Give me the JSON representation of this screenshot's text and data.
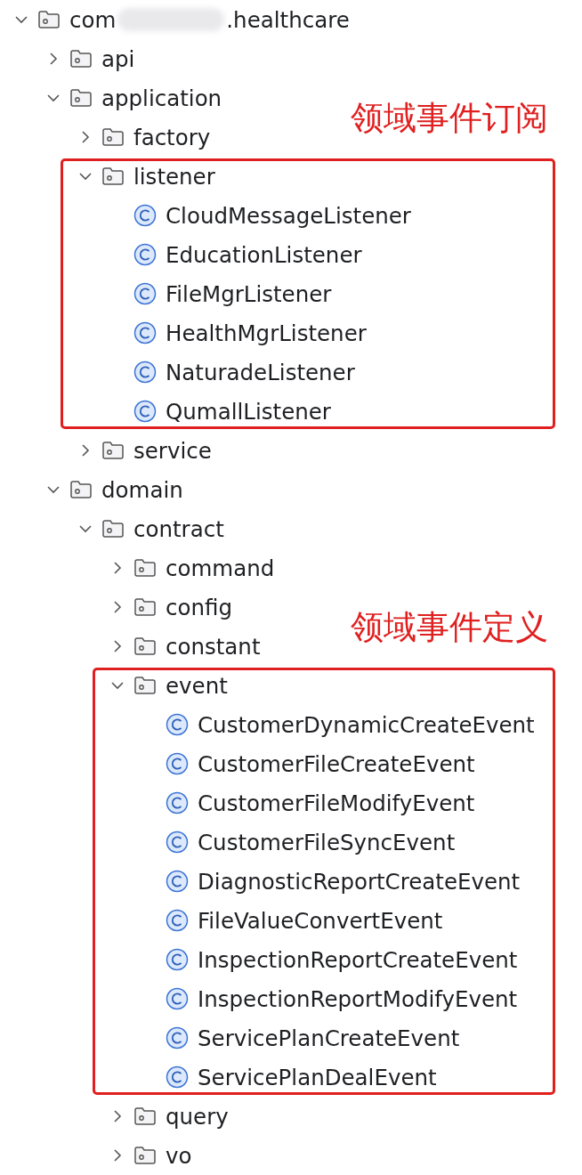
{
  "tree": [
    {
      "kind": "package",
      "label": "com",
      "label_after_blur": ".healthcare",
      "expanded": true,
      "children": [
        {
          "kind": "package",
          "label": "api",
          "expanded": false
        },
        {
          "kind": "package",
          "label": "application",
          "expanded": true,
          "children": [
            {
              "kind": "package",
              "label": "factory",
              "expanded": false
            },
            {
              "kind": "package",
              "label": "listener",
              "expanded": true,
              "highlighted": true,
              "note": "领域事件订阅",
              "children": [
                {
                  "kind": "class",
                  "label": "CloudMessageListener"
                },
                {
                  "kind": "class",
                  "label": "EducationListener"
                },
                {
                  "kind": "class",
                  "label": "FileMgrListener"
                },
                {
                  "kind": "class",
                  "label": "HealthMgrListener"
                },
                {
                  "kind": "class",
                  "label": "NaturadeListener"
                },
                {
                  "kind": "class",
                  "label": "QumallListener"
                }
              ]
            },
            {
              "kind": "package",
              "label": "service",
              "expanded": false
            }
          ]
        },
        {
          "kind": "package",
          "label": "domain",
          "expanded": true,
          "children": [
            {
              "kind": "package",
              "label": "contract",
              "expanded": true,
              "children": [
                {
                  "kind": "package",
                  "label": "command",
                  "expanded": false
                },
                {
                  "kind": "package",
                  "label": "config",
                  "expanded": false
                },
                {
                  "kind": "package",
                  "label": "constant",
                  "expanded": false
                },
                {
                  "kind": "package",
                  "label": "event",
                  "expanded": true,
                  "highlighted": true,
                  "note": "领域事件定义",
                  "children": [
                    {
                      "kind": "class",
                      "label": "CustomerDynamicCreateEvent"
                    },
                    {
                      "kind": "class",
                      "label": "CustomerFileCreateEvent"
                    },
                    {
                      "kind": "class",
                      "label": "CustomerFileModifyEvent"
                    },
                    {
                      "kind": "class",
                      "label": "CustomerFileSyncEvent"
                    },
                    {
                      "kind": "class",
                      "label": "DiagnosticReportCreateEvent"
                    },
                    {
                      "kind": "class",
                      "label": "FileValueConvertEvent"
                    },
                    {
                      "kind": "class",
                      "label": "InspectionReportCreateEvent"
                    },
                    {
                      "kind": "class",
                      "label": "InspectionReportModifyEvent"
                    },
                    {
                      "kind": "class",
                      "label": "ServicePlanCreateEvent"
                    },
                    {
                      "kind": "class",
                      "label": "ServicePlanDealEvent"
                    }
                  ]
                },
                {
                  "kind": "package",
                  "label": "query",
                  "expanded": false
                },
                {
                  "kind": "package",
                  "label": "vo",
                  "expanded": false
                }
              ]
            }
          ]
        }
      ]
    }
  ]
}
